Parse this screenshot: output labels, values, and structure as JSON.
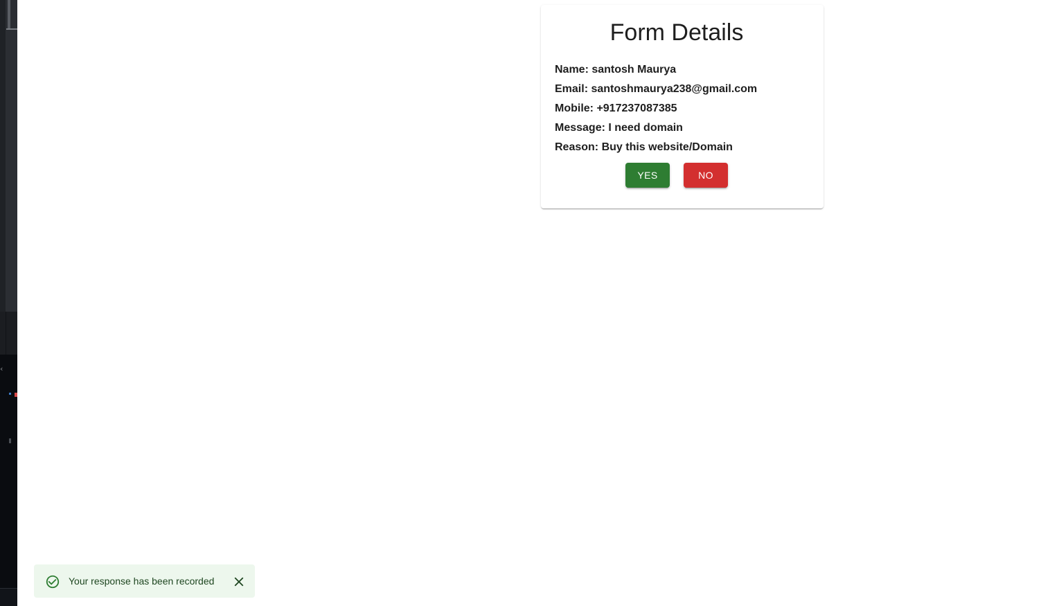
{
  "card": {
    "title": "Form Details",
    "details": [
      {
        "text": "Name: santosh Maurya"
      },
      {
        "text": "Email: santoshmaurya238@gmail.com"
      },
      {
        "text": "Mobile: +917237087385"
      },
      {
        "text": "Message: I need domain"
      },
      {
        "text": "Reason: Buy this website/Domain"
      }
    ],
    "yes_label": "YES",
    "no_label": "NO"
  },
  "snackbar": {
    "message": "Your response has been recorded",
    "icon": "check-circle-icon",
    "close_icon": "close-icon"
  },
  "colors": {
    "yes_button": "#2e7d32",
    "no_button": "#d32f2f",
    "snackbar_bg": "#edf7ed",
    "snackbar_text": "#1e4620"
  }
}
